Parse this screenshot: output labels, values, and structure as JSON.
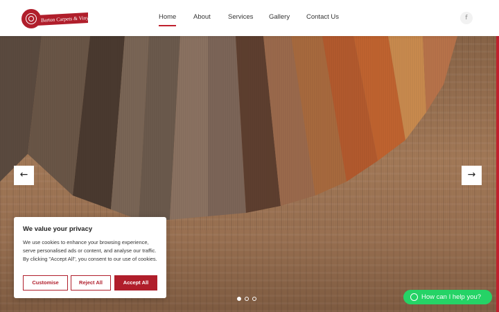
{
  "brand": {
    "logo_text": "Barton Carpets & Vinyls",
    "accent": "#c0202e"
  },
  "nav": {
    "items": [
      {
        "label": "Home",
        "active": true
      },
      {
        "label": "About"
      },
      {
        "label": "Services"
      },
      {
        "label": "Gallery"
      },
      {
        "label": "Contact Us"
      }
    ],
    "social_icon": "facebook-icon",
    "social_glyph": "f"
  },
  "hero": {
    "prev_glyph": "←",
    "next_glyph": "→",
    "slide_count": 3,
    "active_slide": 1
  },
  "cookie": {
    "title": "We value your privacy",
    "body": "We use cookies to enhance your browsing experience, serve personalised ads or content, and analyse our traffic. By clicking \"Accept All\", you consent to our use of cookies.",
    "customise_label": "Customise",
    "reject_label": "Reject All",
    "accept_label": "Accept All"
  },
  "whatsapp": {
    "label": "How can I help you?",
    "color": "#25d366"
  }
}
